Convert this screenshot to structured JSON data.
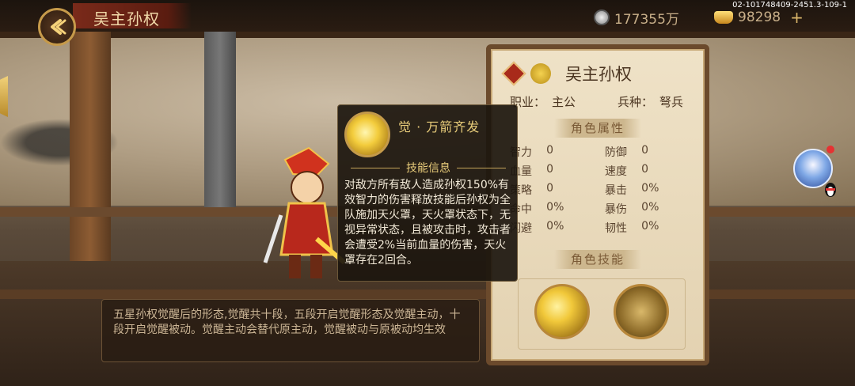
{
  "header": {
    "title": "吴主孙权",
    "silver_amount": "177355万",
    "gold_amount": "98298",
    "plus_label": "+",
    "version_text": "02-101748409-2451.3-109-1"
  },
  "hero_panel": {
    "name": "吴主孙权",
    "job_label": "职业：",
    "job_value": "主公",
    "troop_label": "兵种：",
    "troop_value": "弩兵",
    "attr_section_title": "角色属性",
    "attributes": [
      {
        "l1": "智力",
        "v1": "0",
        "l2": "防御",
        "v2": "0"
      },
      {
        "l1": "血量",
        "v1": "0",
        "l2": "速度",
        "v2": "0"
      },
      {
        "l1": "策略",
        "v1": "0",
        "l2": "暴击",
        "v2": "0%"
      },
      {
        "l1": "命中",
        "v1": "0%",
        "l2": "暴伤",
        "v2": "0%"
      },
      {
        "l1": "闪避",
        "v1": "0%",
        "l2": "韧性",
        "v2": "0%"
      }
    ],
    "skill_section_title": "角色技能"
  },
  "tooltip": {
    "skill_name": "觉 · 万箭齐发",
    "section_label": "技能信息",
    "description": "对敌方所有敌人造成孙权150%有效智力的伤害释放技能后孙权为全队施加天火罩，天火罩状态下，无视异常状态，且被攻击时，攻击者会遭受2%当前血量的伤害，天火罩存在2回合。"
  },
  "description_box": {
    "text": "五星孙权觉醒后的形态,觉醒共十段，五段开启觉醒形态及觉醒主动，十段开启觉醒被动。觉醒主动会替代原主动，觉醒被动与原被动均生效"
  },
  "colors": {
    "panel_bg": "#efe2c7",
    "tooltip_text": "#f3ead8",
    "tooltip_title": "#e8cc7a",
    "gold_accent": "#c69a4a"
  },
  "icons": [
    "back-arrow-icon",
    "silver-coin-icon",
    "gold-ingot-icon",
    "faction-seal-icon",
    "wu-kingdom-icon",
    "skill-arrow-volley-icon",
    "skill-passive-icon",
    "qq-penguin-icon"
  ]
}
